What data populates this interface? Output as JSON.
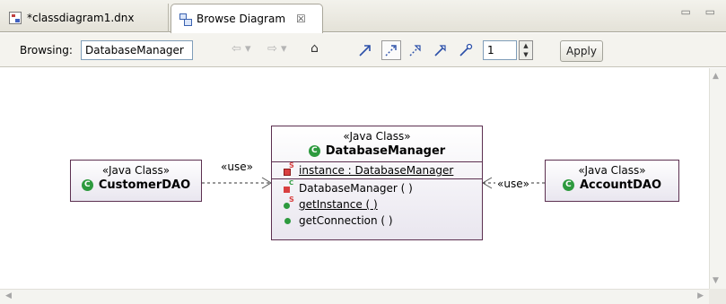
{
  "tabs": [
    {
      "label": "*classdiagram1.dnx",
      "icon": "class-diagram-file-icon"
    },
    {
      "label": "Browse Diagram",
      "icon": "browse-diagram-icon",
      "close": "☒"
    }
  ],
  "window_controls": "▭ ▭",
  "toolbar": {
    "browsing_label": "Browsing:",
    "browsing_value": "DatabaseManager",
    "back_icon": "⇦ ▾",
    "forward_icon": "⇨ ▾",
    "home_icon": "⌂",
    "depth_value": "1",
    "apply_label": "Apply"
  },
  "diagram": {
    "classes": [
      {
        "stereotype": "«Java Class»",
        "name": "CustomerDAO"
      },
      {
        "stereotype": "«Java Class»",
        "name": "DatabaseManager",
        "fields": [
          "instance : DatabaseManager"
        ],
        "methods": [
          "DatabaseManager ( )",
          "getInstance ( )",
          "getConnection ( )"
        ]
      },
      {
        "stereotype": "«Java Class»",
        "name": "AccountDAO"
      }
    ],
    "relations": [
      {
        "label": "«use»"
      },
      {
        "label": "«use»"
      }
    ]
  },
  "colors": {
    "class_border": "#5c3050",
    "class_icon": "#2d9a3e",
    "field_icon": "#d94040",
    "toolbar_arrows": "#2b4fa8"
  }
}
